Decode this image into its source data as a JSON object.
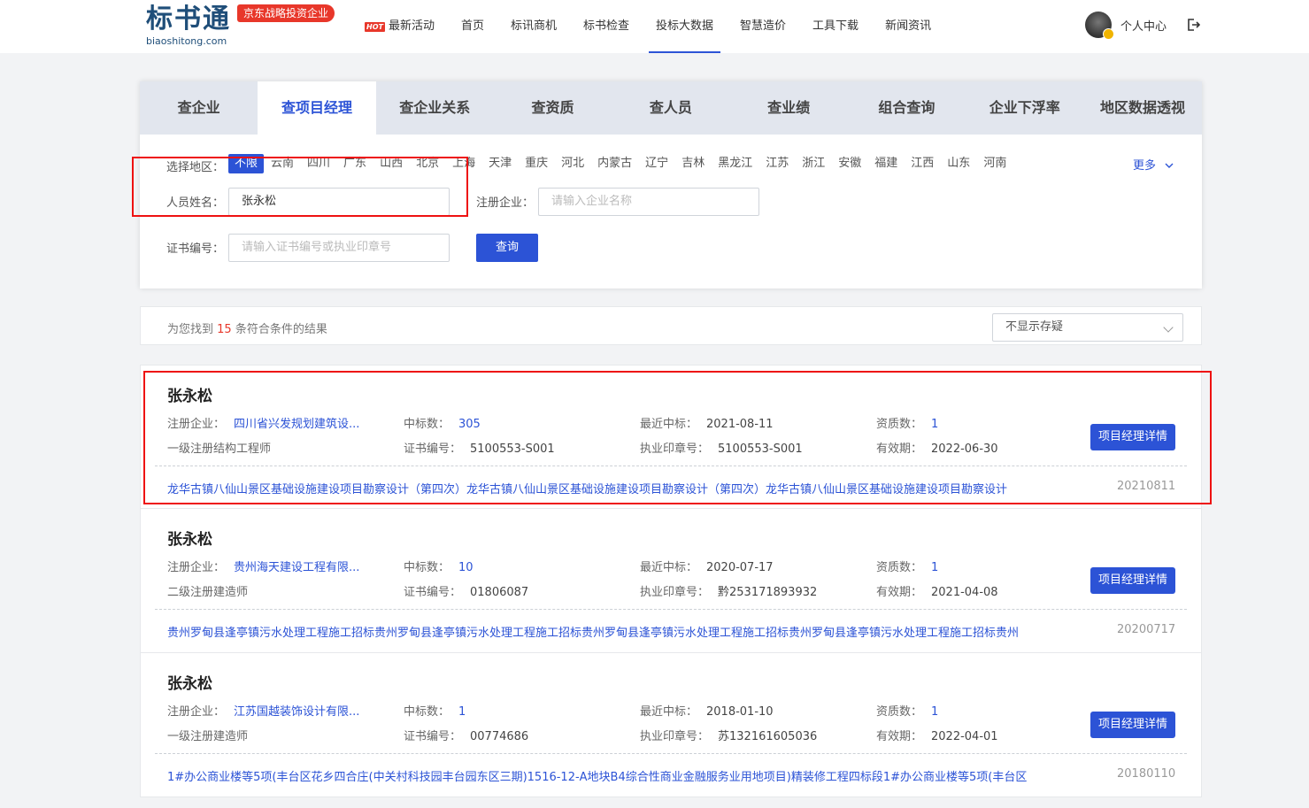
{
  "brand": {
    "logo_text": "标书通",
    "logo_domain": "biaoshitong.com",
    "badge": "京东战略投资企业"
  },
  "nav": {
    "hot_tag": "HOT",
    "items": [
      {
        "label": "最新活动"
      },
      {
        "label": "首页"
      },
      {
        "label": "标讯商机"
      },
      {
        "label": "标书检查"
      },
      {
        "label": "投标大数据"
      },
      {
        "label": "智慧造价"
      },
      {
        "label": "工具下载"
      },
      {
        "label": "新闻资讯"
      }
    ],
    "active_index": 4,
    "user_label": "个人中心"
  },
  "tabs": [
    "查企业",
    "查项目经理",
    "查企业关系",
    "查资质",
    "查人员",
    "查业绩",
    "组合查询",
    "企业下浮率",
    "地区数据透视"
  ],
  "filters": {
    "region_label": "选择地区：",
    "regions": [
      "不限",
      "云南",
      "四川",
      "广东",
      "山西",
      "北京",
      "上海",
      "天津",
      "重庆",
      "河北",
      "内蒙古",
      "辽宁",
      "吉林",
      "黑龙江",
      "江苏",
      "浙江",
      "安徽",
      "福建",
      "江西",
      "山东",
      "河南"
    ],
    "more": "更多",
    "name_label": "人员姓名：",
    "name_value": "张永松",
    "company_label": "注册企业：",
    "company_placeholder": "请输入企业名称",
    "cert_label": "证书编号：",
    "cert_placeholder": "请输入证书编号或执业印章号",
    "query_button": "查询"
  },
  "results": {
    "prefix": "为您找到",
    "count": "15",
    "suffix": "条符合条件的结果",
    "sort_select": "不显示存疑"
  },
  "labels": {
    "company": "注册企业：",
    "wins": "中标数：",
    "latest": "最近中标：",
    "quals": "资质数：",
    "cert": "证书编号：",
    "seal": "执业印章号：",
    "valid": "有效期：",
    "detail_button": "项目经理详情"
  },
  "cards": [
    {
      "name": "张永松",
      "company": "四川省兴发规划建筑设...",
      "wins": "305",
      "latest": "2021-08-11",
      "quals": "1",
      "title": "一级注册结构工程师",
      "cert": "5100553-S001",
      "seal": "5100553-S001",
      "valid": "2022-06-30",
      "project": "龙华古镇八仙山景区基础设施建设项目勘察设计（第四次）龙华古镇八仙山景区基础设施建设项目勘察设计（第四次）龙华古镇八仙山景区基础设施建设项目勘察设计",
      "date": "20210811"
    },
    {
      "name": "张永松",
      "company": "贵州海天建设工程有限...",
      "wins": "10",
      "latest": "2020-07-17",
      "quals": "1",
      "title": "二级注册建造师",
      "cert": "01806087",
      "seal": "黔253171893932",
      "valid": "2021-04-08",
      "project": "贵州罗甸县逢亭镇污水处理工程施工招标贵州罗甸县逢亭镇污水处理工程施工招标贵州罗甸县逢亭镇污水处理工程施工招标贵州罗甸县逢亭镇污水处理工程施工招标贵州",
      "date": "20200717"
    },
    {
      "name": "张永松",
      "company": "江苏国越装饰设计有限...",
      "wins": "1",
      "latest": "2018-01-10",
      "quals": "1",
      "title": "一级注册建造师",
      "cert": "00774686",
      "seal": "苏132161605036",
      "valid": "2022-04-01",
      "project": "1#办公商业楼等5项(丰台区花乡四合庄(中关村科技园丰台园东区三期)1516-12-A地块B4综合性商业金融服务业用地项目)精装修工程四标段1#办公商业楼等5项(丰台区",
      "date": "20180110"
    }
  ],
  "colors": {
    "accent": "#2c53d6",
    "hot": "#e8372a",
    "highlight_box": "#ee1111"
  }
}
